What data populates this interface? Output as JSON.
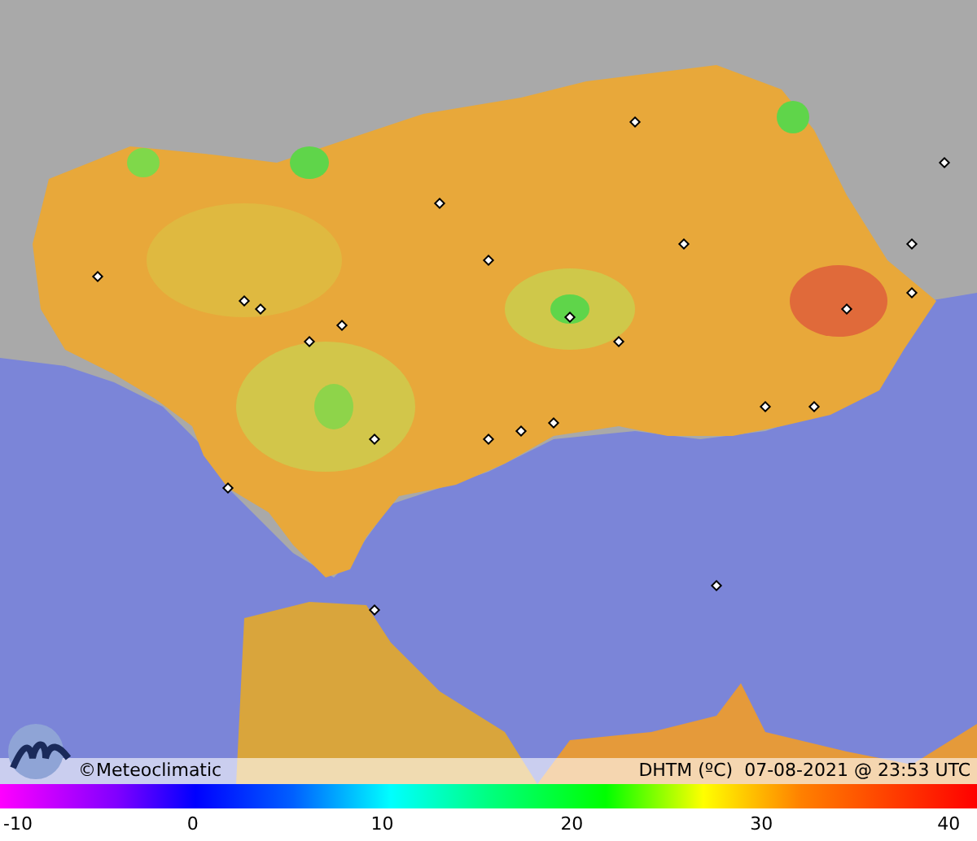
{
  "caption": {
    "brand": "©Meteoclimatic",
    "info": "DHTM (ºC)  07-08-2021 @ 23:53 UTC"
  },
  "scale": {
    "ticks": [
      "-10",
      "0",
      "10",
      "20",
      "30",
      "40"
    ]
  }
}
